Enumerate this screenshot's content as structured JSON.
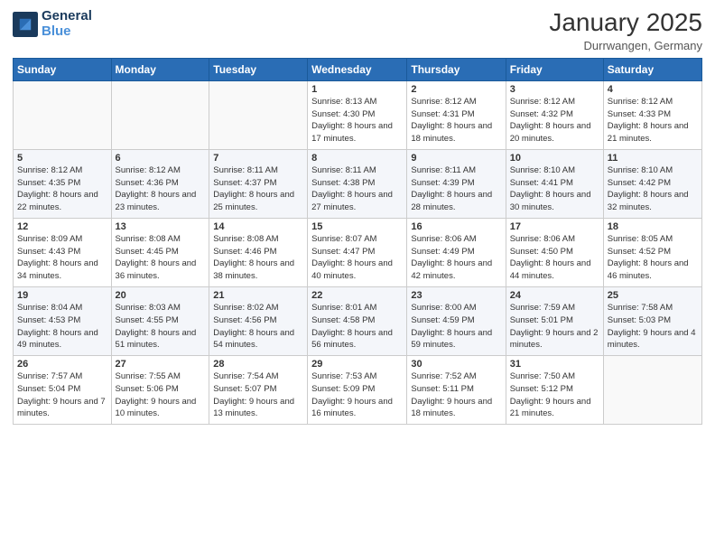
{
  "header": {
    "logo_line1": "General",
    "logo_line2": "Blue",
    "month_title": "January 2025",
    "location": "Durrwangen, Germany"
  },
  "days_of_week": [
    "Sunday",
    "Monday",
    "Tuesday",
    "Wednesday",
    "Thursday",
    "Friday",
    "Saturday"
  ],
  "weeks": [
    [
      {
        "day": "",
        "sunrise": "",
        "sunset": "",
        "daylight": ""
      },
      {
        "day": "",
        "sunrise": "",
        "sunset": "",
        "daylight": ""
      },
      {
        "day": "",
        "sunrise": "",
        "sunset": "",
        "daylight": ""
      },
      {
        "day": "1",
        "sunrise": "Sunrise: 8:13 AM",
        "sunset": "Sunset: 4:30 PM",
        "daylight": "Daylight: 8 hours and 17 minutes."
      },
      {
        "day": "2",
        "sunrise": "Sunrise: 8:12 AM",
        "sunset": "Sunset: 4:31 PM",
        "daylight": "Daylight: 8 hours and 18 minutes."
      },
      {
        "day": "3",
        "sunrise": "Sunrise: 8:12 AM",
        "sunset": "Sunset: 4:32 PM",
        "daylight": "Daylight: 8 hours and 20 minutes."
      },
      {
        "day": "4",
        "sunrise": "Sunrise: 8:12 AM",
        "sunset": "Sunset: 4:33 PM",
        "daylight": "Daylight: 8 hours and 21 minutes."
      }
    ],
    [
      {
        "day": "5",
        "sunrise": "Sunrise: 8:12 AM",
        "sunset": "Sunset: 4:35 PM",
        "daylight": "Daylight: 8 hours and 22 minutes."
      },
      {
        "day": "6",
        "sunrise": "Sunrise: 8:12 AM",
        "sunset": "Sunset: 4:36 PM",
        "daylight": "Daylight: 8 hours and 23 minutes."
      },
      {
        "day": "7",
        "sunrise": "Sunrise: 8:11 AM",
        "sunset": "Sunset: 4:37 PM",
        "daylight": "Daylight: 8 hours and 25 minutes."
      },
      {
        "day": "8",
        "sunrise": "Sunrise: 8:11 AM",
        "sunset": "Sunset: 4:38 PM",
        "daylight": "Daylight: 8 hours and 27 minutes."
      },
      {
        "day": "9",
        "sunrise": "Sunrise: 8:11 AM",
        "sunset": "Sunset: 4:39 PM",
        "daylight": "Daylight: 8 hours and 28 minutes."
      },
      {
        "day": "10",
        "sunrise": "Sunrise: 8:10 AM",
        "sunset": "Sunset: 4:41 PM",
        "daylight": "Daylight: 8 hours and 30 minutes."
      },
      {
        "day": "11",
        "sunrise": "Sunrise: 8:10 AM",
        "sunset": "Sunset: 4:42 PM",
        "daylight": "Daylight: 8 hours and 32 minutes."
      }
    ],
    [
      {
        "day": "12",
        "sunrise": "Sunrise: 8:09 AM",
        "sunset": "Sunset: 4:43 PM",
        "daylight": "Daylight: 8 hours and 34 minutes."
      },
      {
        "day": "13",
        "sunrise": "Sunrise: 8:08 AM",
        "sunset": "Sunset: 4:45 PM",
        "daylight": "Daylight: 8 hours and 36 minutes."
      },
      {
        "day": "14",
        "sunrise": "Sunrise: 8:08 AM",
        "sunset": "Sunset: 4:46 PM",
        "daylight": "Daylight: 8 hours and 38 minutes."
      },
      {
        "day": "15",
        "sunrise": "Sunrise: 8:07 AM",
        "sunset": "Sunset: 4:47 PM",
        "daylight": "Daylight: 8 hours and 40 minutes."
      },
      {
        "day": "16",
        "sunrise": "Sunrise: 8:06 AM",
        "sunset": "Sunset: 4:49 PM",
        "daylight": "Daylight: 8 hours and 42 minutes."
      },
      {
        "day": "17",
        "sunrise": "Sunrise: 8:06 AM",
        "sunset": "Sunset: 4:50 PM",
        "daylight": "Daylight: 8 hours and 44 minutes."
      },
      {
        "day": "18",
        "sunrise": "Sunrise: 8:05 AM",
        "sunset": "Sunset: 4:52 PM",
        "daylight": "Daylight: 8 hours and 46 minutes."
      }
    ],
    [
      {
        "day": "19",
        "sunrise": "Sunrise: 8:04 AM",
        "sunset": "Sunset: 4:53 PM",
        "daylight": "Daylight: 8 hours and 49 minutes."
      },
      {
        "day": "20",
        "sunrise": "Sunrise: 8:03 AM",
        "sunset": "Sunset: 4:55 PM",
        "daylight": "Daylight: 8 hours and 51 minutes."
      },
      {
        "day": "21",
        "sunrise": "Sunrise: 8:02 AM",
        "sunset": "Sunset: 4:56 PM",
        "daylight": "Daylight: 8 hours and 54 minutes."
      },
      {
        "day": "22",
        "sunrise": "Sunrise: 8:01 AM",
        "sunset": "Sunset: 4:58 PM",
        "daylight": "Daylight: 8 hours and 56 minutes."
      },
      {
        "day": "23",
        "sunrise": "Sunrise: 8:00 AM",
        "sunset": "Sunset: 4:59 PM",
        "daylight": "Daylight: 8 hours and 59 minutes."
      },
      {
        "day": "24",
        "sunrise": "Sunrise: 7:59 AM",
        "sunset": "Sunset: 5:01 PM",
        "daylight": "Daylight: 9 hours and 2 minutes."
      },
      {
        "day": "25",
        "sunrise": "Sunrise: 7:58 AM",
        "sunset": "Sunset: 5:03 PM",
        "daylight": "Daylight: 9 hours and 4 minutes."
      }
    ],
    [
      {
        "day": "26",
        "sunrise": "Sunrise: 7:57 AM",
        "sunset": "Sunset: 5:04 PM",
        "daylight": "Daylight: 9 hours and 7 minutes."
      },
      {
        "day": "27",
        "sunrise": "Sunrise: 7:55 AM",
        "sunset": "Sunset: 5:06 PM",
        "daylight": "Daylight: 9 hours and 10 minutes."
      },
      {
        "day": "28",
        "sunrise": "Sunrise: 7:54 AM",
        "sunset": "Sunset: 5:07 PM",
        "daylight": "Daylight: 9 hours and 13 minutes."
      },
      {
        "day": "29",
        "sunrise": "Sunrise: 7:53 AM",
        "sunset": "Sunset: 5:09 PM",
        "daylight": "Daylight: 9 hours and 16 minutes."
      },
      {
        "day": "30",
        "sunrise": "Sunrise: 7:52 AM",
        "sunset": "Sunset: 5:11 PM",
        "daylight": "Daylight: 9 hours and 18 minutes."
      },
      {
        "day": "31",
        "sunrise": "Sunrise: 7:50 AM",
        "sunset": "Sunset: 5:12 PM",
        "daylight": "Daylight: 9 hours and 21 minutes."
      },
      {
        "day": "",
        "sunrise": "",
        "sunset": "",
        "daylight": ""
      }
    ]
  ]
}
